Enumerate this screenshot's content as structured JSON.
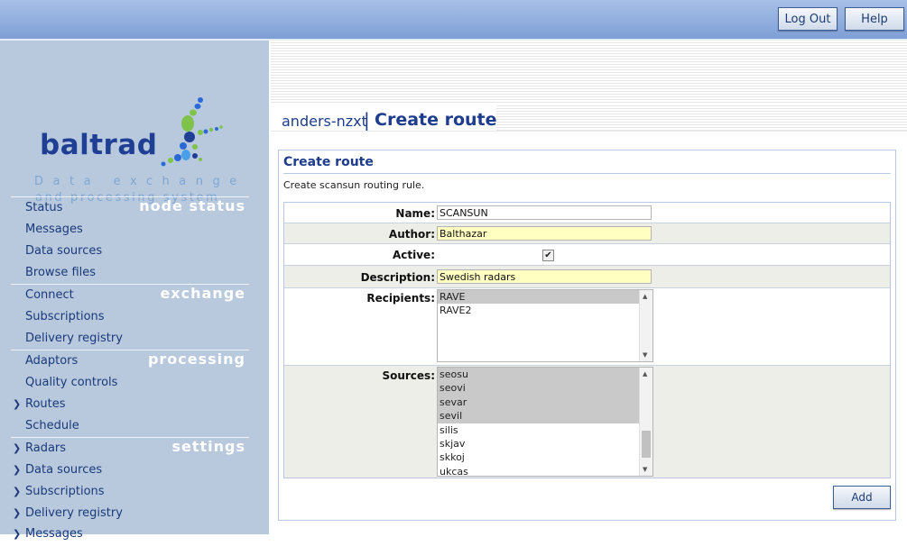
{
  "topbar": {
    "logout_label": "Log Out",
    "help_label": "Help"
  },
  "logo": {
    "word": "baltrad",
    "tagline_line1": "Data exchange",
    "tagline_line2": "and processing system"
  },
  "sidebar": {
    "sections": [
      {
        "title": "node status",
        "items": [
          {
            "label": "Status"
          },
          {
            "label": "Messages"
          },
          {
            "label": "Data sources"
          },
          {
            "label": "Browse files"
          }
        ]
      },
      {
        "title": "exchange",
        "items": [
          {
            "label": "Connect"
          },
          {
            "label": "Subscriptions"
          },
          {
            "label": "Delivery registry"
          }
        ]
      },
      {
        "title": "processing",
        "items": [
          {
            "label": "Adaptors"
          },
          {
            "label": "Quality controls"
          },
          {
            "label": "Routes",
            "expandable": true
          },
          {
            "label": "Schedule"
          }
        ]
      },
      {
        "title": "settings",
        "items": [
          {
            "label": "Radars",
            "expandable": true
          },
          {
            "label": "Data sources",
            "expandable": true
          },
          {
            "label": "Subscriptions",
            "expandable": true
          },
          {
            "label": "Delivery registry",
            "expandable": true
          },
          {
            "label": "Messages",
            "expandable": true
          }
        ]
      }
    ]
  },
  "header": {
    "node_name": "anders-nzxt",
    "separator": "|",
    "page_title": "Create route"
  },
  "panel": {
    "title": "Create route",
    "description": "Create scansun routing rule.",
    "form": {
      "name_label": "Name:",
      "name_value": "SCANSUN",
      "author_label": "Author:",
      "author_value": "Balthazar",
      "active_label": "Active:",
      "active_checked": true,
      "active_mark": "✔",
      "description_label": "Description:",
      "description_value": "Swedish radars",
      "recipients_label": "Recipients:",
      "recipients": [
        {
          "label": "RAVE",
          "selected": true
        },
        {
          "label": "RAVE2",
          "selected": false
        }
      ],
      "sources_label": "Sources:",
      "sources": [
        {
          "label": "seosu",
          "selected": true
        },
        {
          "label": "seovi",
          "selected": true
        },
        {
          "label": "sevar",
          "selected": true
        },
        {
          "label": "sevil",
          "selected": true
        },
        {
          "label": "silis",
          "selected": false
        },
        {
          "label": "skjav",
          "selected": false
        },
        {
          "label": "skkoj",
          "selected": false
        },
        {
          "label": "ukcas",
          "selected": false
        }
      ]
    },
    "add_label": "Add"
  },
  "colors": {
    "accent": "#1d3c8c",
    "sidebar_bg": "#b8c9de",
    "highlight_yellow": "#ffffc2",
    "topbar": "#7e9fd6"
  }
}
